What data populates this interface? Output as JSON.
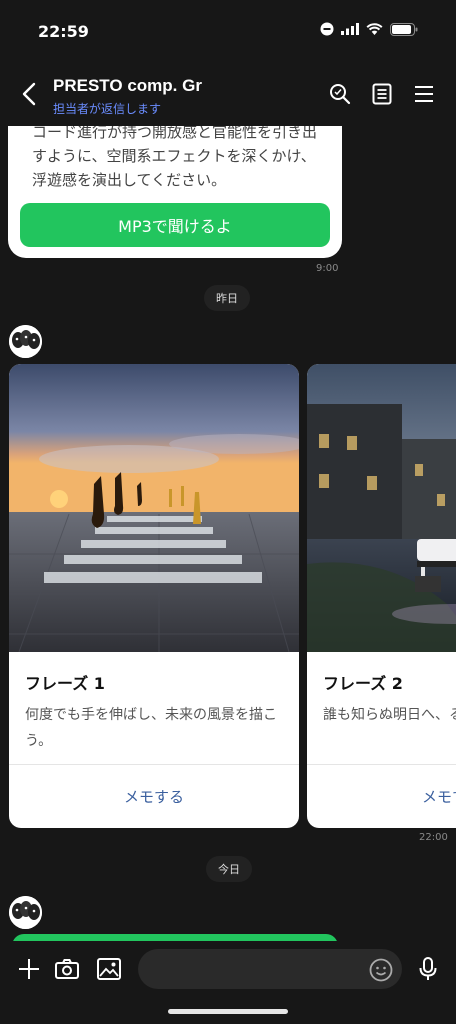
{
  "status": {
    "time": "22:59"
  },
  "header": {
    "title": "PRESTO comp. Gr",
    "subtitle": "担当者が返信します"
  },
  "message_top": {
    "text": "コード進行が持つ開放感と官能性を引き出すように、空間系エフェクトを深くかけ、浮遊感を演出してください。",
    "button_label": "MP3で聞けるよ",
    "time": "9:00"
  },
  "divider_yesterday": "昨日",
  "cards": [
    {
      "title": "フレーズ 1",
      "desc": "何度でも手を伸ばし、未来の風景を描こう。",
      "action": "メモする"
    },
    {
      "title": "フレーズ 2",
      "desc": "誰も知らぬ明日へ、る。",
      "action": "メモする"
    }
  ],
  "cards_time": "22:00",
  "divider_today": "今日",
  "input": {
    "placeholder": ""
  },
  "colors": {
    "accent_green": "#22c55e",
    "link_blue": "#6b8dff",
    "background": "#171717"
  }
}
